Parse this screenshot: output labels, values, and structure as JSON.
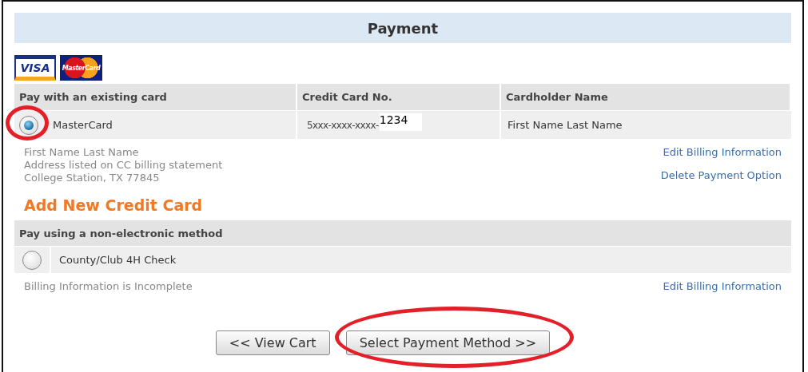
{
  "title": "Payment",
  "card_logos": [
    {
      "kind": "visa",
      "text": "VISA"
    },
    {
      "kind": "mastercard",
      "text": "MasterCard"
    }
  ],
  "existing": {
    "columns": [
      "Pay with an existing card",
      "Credit Card No.",
      "Cardholder Name"
    ],
    "rows": [
      {
        "selected": true,
        "highlighted": true,
        "card_type": "MasterCard",
        "card_number": "5xxx-xxxx-xxxx-",
        "card_number_patch": "1234",
        "cardholder": "First Name Last Name"
      }
    ],
    "address_lines": [
      "First Name Last Name",
      "Address listed on CC billing statement",
      "College Station, TX 77845"
    ],
    "links": [
      "Edit Billing Information",
      "Delete Payment Option"
    ]
  },
  "add_card_link": "Add New Credit Card",
  "non_electronic": {
    "header": "Pay using a non-electronic method",
    "options": [
      {
        "selected": false,
        "label": "County/Club 4H Check"
      }
    ],
    "status": "Billing Information is Incomplete",
    "link": "Edit Billing Information"
  },
  "buttons": [
    {
      "label": "<< View Cart",
      "highlighted": false
    },
    {
      "label": "Select Payment Method >>",
      "highlighted": true
    }
  ]
}
